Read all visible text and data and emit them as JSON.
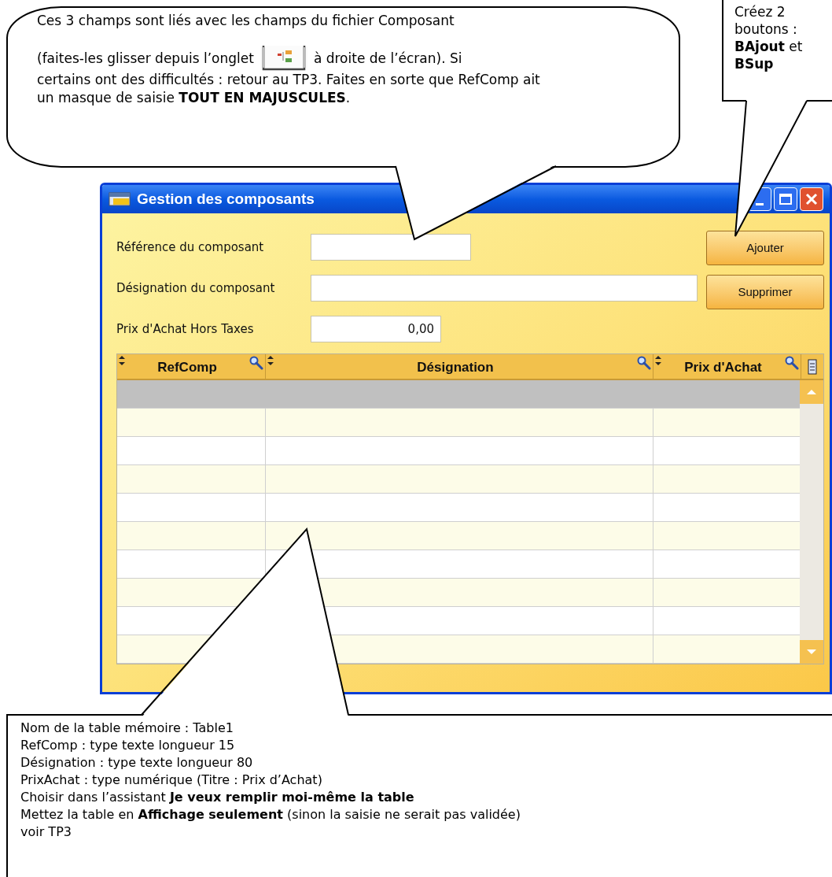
{
  "note_top": {
    "first_line": "Ces 3 champs sont liés avec les champs du fichier Composant",
    "before_icon": "(faites-les glisser depuis l’onglet",
    "after_icon": "à droite de l’écran). Si",
    "continuation": "certains ont des difficultés : retour au TP3. Faites en sorte que RefComp ait un masque de saisie **TOUT EN MAJUSCULES**."
  },
  "note_buttons": {
    "text": "Créez 2 boutons : **BAjout** et **BSup**"
  },
  "window": {
    "title": "Gestion des composants",
    "fields": [
      {
        "label": "Référence du composant",
        "kind": "short"
      },
      {
        "label": "Désignation du composant",
        "kind": "long"
      },
      {
        "label": "Prix d'Achat Hors Taxes",
        "kind": "number",
        "value": "0,00"
      }
    ],
    "buttons": [
      "Ajouter",
      "Supprimer"
    ],
    "table": {
      "columns": [
        "RefComp",
        "Désignation",
        "Prix d'Achat"
      ],
      "rows": [
        {
          "selected": true
        },
        {
          "selected": false
        },
        {
          "selected": false
        },
        {
          "selected": false
        },
        {
          "selected": false
        },
        {
          "selected": false
        },
        {
          "selected": false
        },
        {
          "selected": false
        },
        {
          "selected": false
        },
        {
          "selected": false
        }
      ]
    }
  },
  "note_table": {
    "lines": [
      "Nom de la table mémoire : Table1",
      "RefComp : type texte longueur 15",
      "Désignation : type texte longueur 80",
      "PrixAchat : type numérique (Titre : Prix d’Achat)",
      "Choisir dans l’assistant **Je veux remplir moi-même la table**",
      "Mettez la table en **Affichage seulement** (sinon la saisie ne serait pas validée)",
      "voir TP3"
    ]
  }
}
